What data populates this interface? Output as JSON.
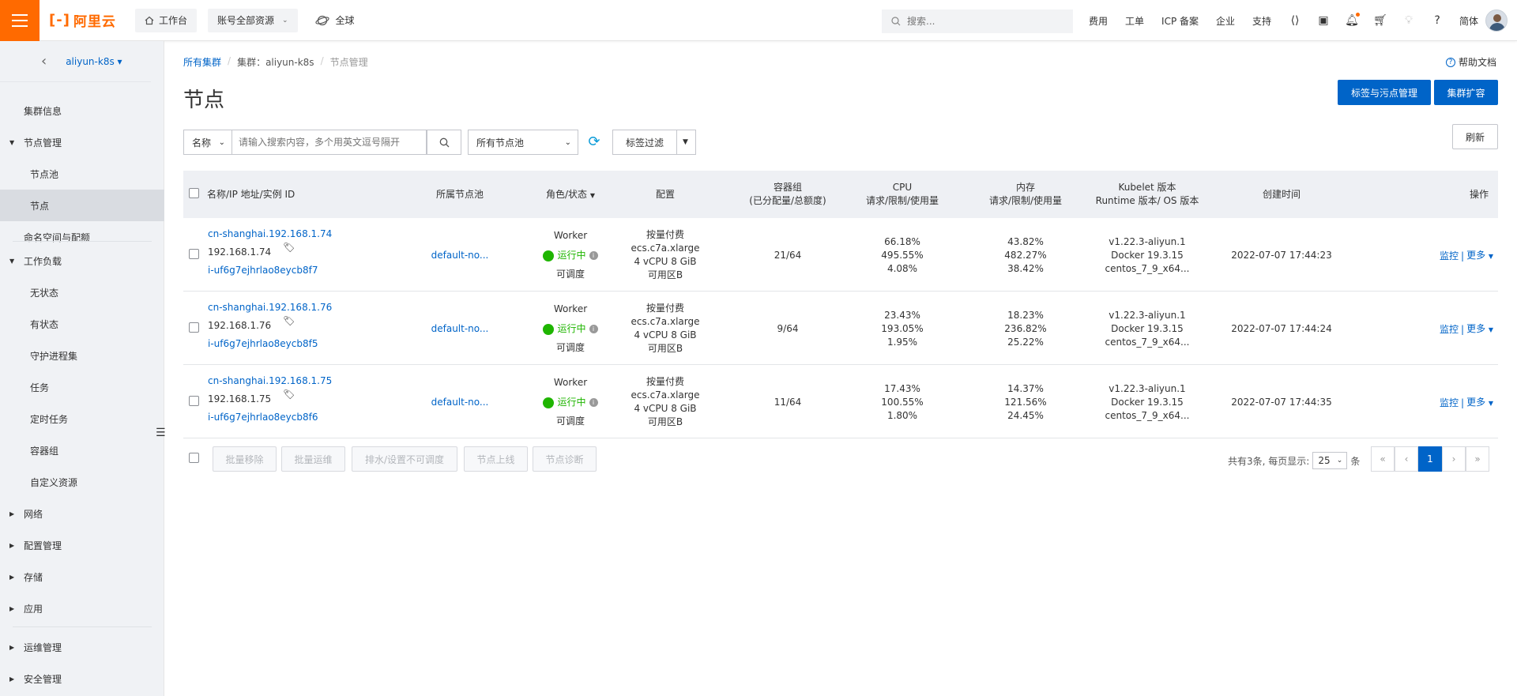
{
  "topbar": {
    "logo_text": "阿里云",
    "workbench": "工作台",
    "account_resources": "账号全部资源",
    "region": "全球",
    "search_placeholder": "搜索...",
    "links": [
      "费用",
      "工单",
      "ICP 备案",
      "企业",
      "支持"
    ],
    "lang": "简体"
  },
  "sidebar": {
    "cluster_name": "aliyun-k8s",
    "items": [
      {
        "label": "集群信息"
      },
      {
        "label": "节点管理"
      },
      {
        "label": "节点池"
      },
      {
        "label": "节点"
      },
      {
        "label": "命名空间与配额"
      },
      {
        "label": "工作负载"
      },
      {
        "label": "无状态"
      },
      {
        "label": "有状态"
      },
      {
        "label": "守护进程集"
      },
      {
        "label": "任务"
      },
      {
        "label": "定时任务"
      },
      {
        "label": "容器组"
      },
      {
        "label": "自定义资源"
      },
      {
        "label": "网络"
      },
      {
        "label": "配置管理"
      },
      {
        "label": "存储"
      },
      {
        "label": "应用"
      },
      {
        "label": "运维管理"
      },
      {
        "label": "安全管理"
      }
    ]
  },
  "breadcrumb": {
    "all_clusters": "所有集群",
    "cluster": "集群：aliyun-k8s",
    "current": "节点管理"
  },
  "help_doc": "帮助文档",
  "page_title": "节点",
  "buttons": {
    "label_taint": "标签与污点管理",
    "scale_out": "集群扩容",
    "refresh": "刷新"
  },
  "filters": {
    "field": "名称",
    "search_placeholder": "请输入搜索内容，多个用英文逗号隔开",
    "node_pool": "所有节点池",
    "tag_filter": "标签过滤"
  },
  "table": {
    "headers": {
      "name": "名称/IP 地址/实例 ID",
      "pool": "所属节点池",
      "role": "角色/状态",
      "config": "配置",
      "pods_1": "容器组",
      "pods_2": "(已分配量/总额度)",
      "cpu_1": "CPU",
      "cpu_2": "请求/限制/使用量",
      "mem_1": "内存",
      "mem_2": "请求/限制/使用量",
      "kubelet_1": "Kubelet 版本",
      "kubelet_2": "Runtime 版本/ OS 版本",
      "created": "创建时间",
      "ops": "操作"
    },
    "rows": [
      {
        "name": "cn-shanghai.192.168.1.74",
        "ip": "192.168.1.74",
        "instance": "i-uf6g7ejhrlao8eycb8f7",
        "pool": "default-no...",
        "role": "Worker",
        "status": "运行中",
        "sched": "可调度",
        "billing": "按量付费",
        "type": "ecs.c7a.xlarge",
        "spec": "4 vCPU 8 GiB",
        "zone": "可用区B",
        "pods": "21/64",
        "cpu_req": "66.18%",
        "cpu_lim": "495.55%",
        "cpu_use": "4.08%",
        "mem_req": "43.82%",
        "mem_lim": "482.27%",
        "mem_use": "38.42%",
        "kubelet": "v1.22.3-aliyun.1",
        "runtime": "Docker 19.3.15",
        "os": "centos_7_9_x64...",
        "created": "2022-07-07 17:44:23",
        "monitor": "监控",
        "more": "更多"
      },
      {
        "name": "cn-shanghai.192.168.1.76",
        "ip": "192.168.1.76",
        "instance": "i-uf6g7ejhrlao8eycb8f5",
        "pool": "default-no...",
        "role": "Worker",
        "status": "运行中",
        "sched": "可调度",
        "billing": "按量付费",
        "type": "ecs.c7a.xlarge",
        "spec": "4 vCPU 8 GiB",
        "zone": "可用区B",
        "pods": "9/64",
        "cpu_req": "23.43%",
        "cpu_lim": "193.05%",
        "cpu_use": "1.95%",
        "mem_req": "18.23%",
        "mem_lim": "236.82%",
        "mem_use": "25.22%",
        "kubelet": "v1.22.3-aliyun.1",
        "runtime": "Docker 19.3.15",
        "os": "centos_7_9_x64...",
        "created": "2022-07-07 17:44:24",
        "monitor": "监控",
        "more": "更多"
      },
      {
        "name": "cn-shanghai.192.168.1.75",
        "ip": "192.168.1.75",
        "instance": "i-uf6g7ejhrlao8eycb8f6",
        "pool": "default-no...",
        "role": "Worker",
        "status": "运行中",
        "sched": "可调度",
        "billing": "按量付费",
        "type": "ecs.c7a.xlarge",
        "spec": "4 vCPU 8 GiB",
        "zone": "可用区B",
        "pods": "11/64",
        "cpu_req": "17.43%",
        "cpu_lim": "100.55%",
        "cpu_use": "1.80%",
        "mem_req": "14.37%",
        "mem_lim": "121.56%",
        "mem_use": "24.45%",
        "kubelet": "v1.22.3-aliyun.1",
        "runtime": "Docker 19.3.15",
        "os": "centos_7_9_x64...",
        "created": "2022-07-07 17:44:35",
        "monitor": "监控",
        "more": "更多"
      }
    ]
  },
  "batch": {
    "remove": "批量移除",
    "ops": "批量运维",
    "drain": "排水/设置不可调度",
    "online": "节点上线",
    "diagnose": "节点诊断"
  },
  "pager": {
    "total": "共有3条, 每页显示:",
    "size": "25",
    "unit": "条",
    "current": "1",
    "first": "«",
    "prev": "‹",
    "next": "›",
    "last": "»"
  },
  "colors": {
    "brand": "#ff6a00",
    "primary": "#0064c8",
    "running": "#1fb500"
  }
}
